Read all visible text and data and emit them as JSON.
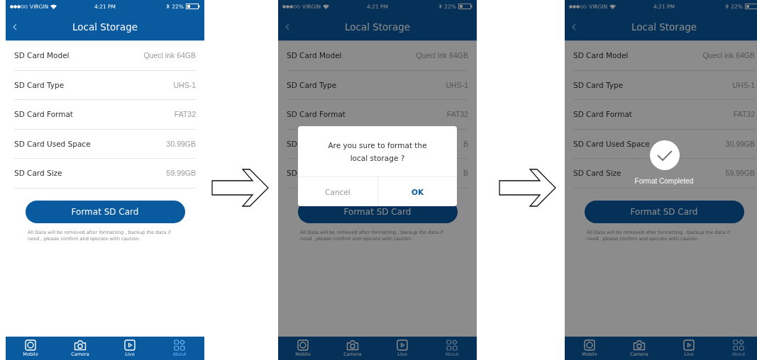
{
  "screens": [
    {
      "status_bar": {
        "carrier": "VIRGIN",
        "time": "4:21 PM",
        "battery": "22%"
      },
      "title": "Local Storage",
      "rows": [
        {
          "label": "SD Card Model",
          "value": "Quecl ink 64GB"
        },
        {
          "label": "SD Card Type",
          "value": "UHS-1"
        },
        {
          "label": "SD Card Format",
          "value": "FAT32"
        },
        {
          "label": "SD Card Used Space",
          "value": "30.99GB"
        },
        {
          "label": "SD Card Size",
          "value": "59.99GB"
        }
      ],
      "button": "Format SD Card",
      "note": "All Data will be removed after formatting , backup the data if need , please confirm and operate with caution.",
      "tabs": [
        {
          "label": "Mobile",
          "kind": "mobile",
          "selected": false
        },
        {
          "label": "Camera",
          "kind": "camera",
          "selected": false
        },
        {
          "label": "Live",
          "kind": "live",
          "selected": false
        },
        {
          "label": "About",
          "kind": "about",
          "selected": true
        }
      ],
      "dimmed": false
    },
    {
      "status_bar": {
        "carrier": "VIRGIN",
        "time": "4:21 PM",
        "battery": "22%"
      },
      "title": "Local Storage",
      "rows": [
        {
          "label": "SD Card Model",
          "value": "Quecl ink 64GB"
        },
        {
          "label": "SD Card Type",
          "value": "UHS-1"
        },
        {
          "label": "SD Card Format",
          "value": "FAT32"
        },
        {
          "label": "SD",
          "value": "B"
        },
        {
          "label": "SD",
          "value": "B"
        }
      ],
      "button": "Format SD Card",
      "note": "All Data will be removed after formatting , backup the data if need , please confirm and operate with caution.",
      "tabs": [
        {
          "label": "Mobile",
          "kind": "mobile",
          "selected": false
        },
        {
          "label": "Camera",
          "kind": "camera",
          "selected": false
        },
        {
          "label": "Live",
          "kind": "live",
          "selected": false
        },
        {
          "label": "About",
          "kind": "about",
          "selected": true
        }
      ],
      "dimmed": true,
      "dialog": {
        "message": "Are you sure to format the local storage ?",
        "buttons": [
          {
            "label": "Cancel",
            "kind": "cancel"
          },
          {
            "label": "OK",
            "kind": "confirm"
          }
        ]
      }
    },
    {
      "status_bar": {
        "carrier": "VIRGIN",
        "time": "4:21 PM",
        "battery": "22%"
      },
      "title": "Local Storage",
      "rows": [
        {
          "label": "SD Card Model",
          "value": "Quecl ink 64GB"
        },
        {
          "label": "SD Card Type",
          "value": "UHS-1"
        },
        {
          "label": "SD Card Format",
          "value": "FAT32"
        },
        {
          "label": "SD Card Used Space",
          "value": "30.99GB"
        },
        {
          "label": "SD Card Size",
          "value": "59.99GB"
        }
      ],
      "button": "Format SD Card",
      "note": "All Data will be removed after formatting , backup the data if need , please confirm and operate with caution.",
      "tabs": [
        {
          "label": "Mobile",
          "kind": "mobile",
          "selected": false
        },
        {
          "label": "Camera",
          "kind": "camera",
          "selected": false
        },
        {
          "label": "Live",
          "kind": "live",
          "selected": false
        },
        {
          "label": "About",
          "kind": "about",
          "selected": true
        }
      ],
      "dimmed": true,
      "toast": {
        "message": "Format Completed"
      }
    }
  ]
}
